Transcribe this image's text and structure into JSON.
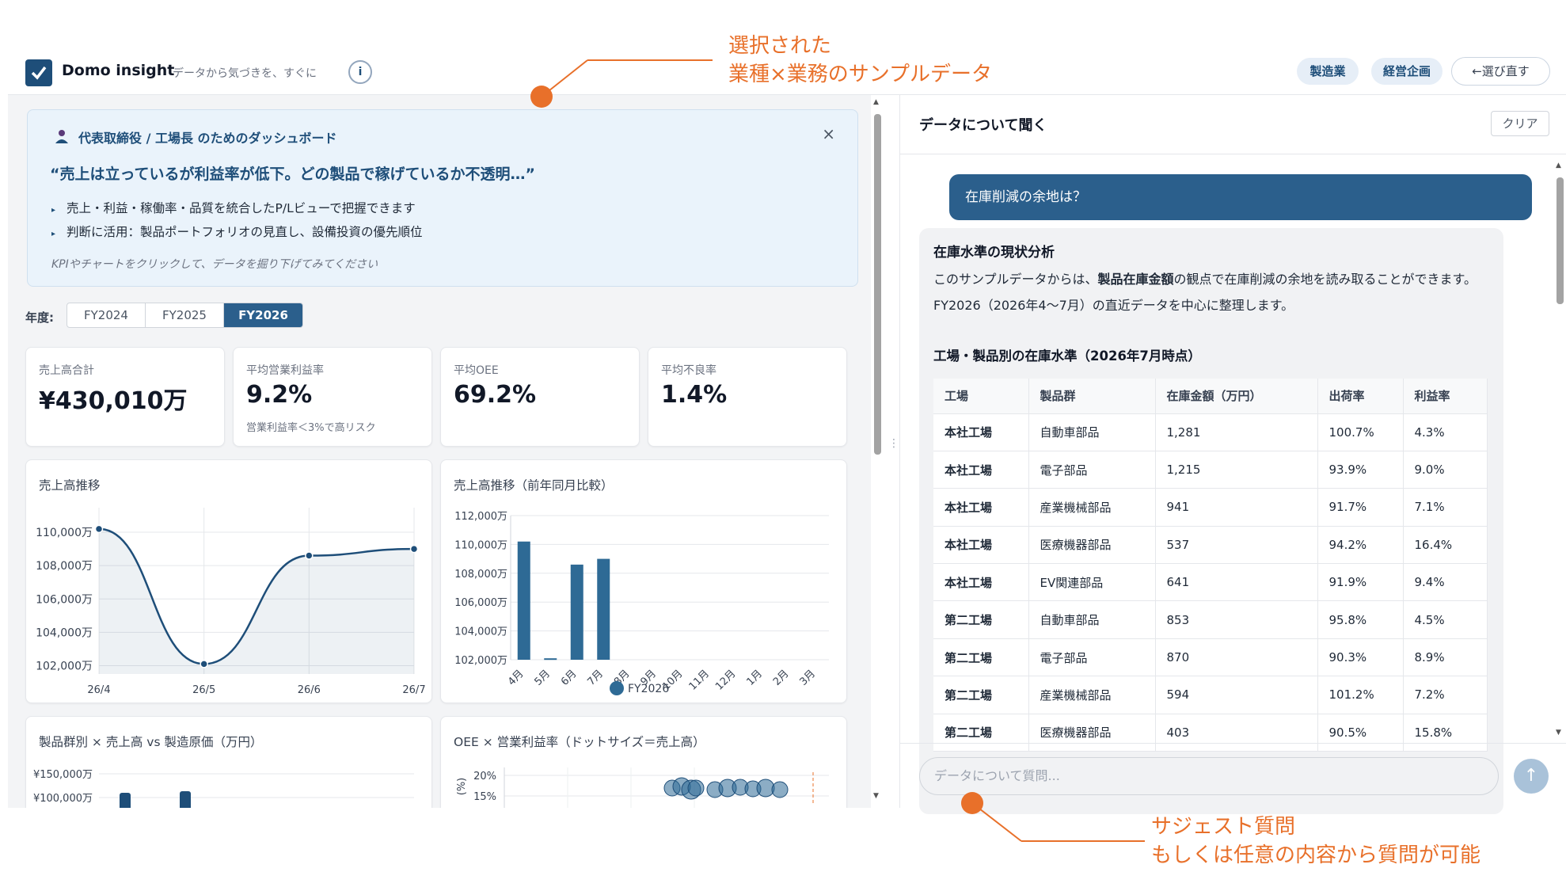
{
  "header": {
    "brand": "Domo insight",
    "tagline": "データから気づきを、すぐに",
    "info_icon": "ⓘ",
    "tags": [
      "製造業",
      "経営企画"
    ],
    "reselect": "←選び直す"
  },
  "banner": {
    "heading": "代表取締役 / 工場長 のためのダッシュボード",
    "quote": "“売上は立っているが利益率が低下。どの製品で稼げているか不透明…”",
    "bullets": [
      "売上・利益・稼働率・品質を統合したP/Lビューで把握できます",
      "判断に活用：製品ポートフォリオの見直し、設備投資の優先順位"
    ],
    "hint": "KPIやチャートをクリックして、データを掘り下げてみてください",
    "close": "×"
  },
  "fiscal_year": {
    "label": "年度:",
    "options": [
      "FY2024",
      "FY2025",
      "FY2026"
    ],
    "selected": "FY2026"
  },
  "kpis": [
    {
      "label": "売上高合計",
      "value": "¥430,010万",
      "sub": ""
    },
    {
      "label": "平均営業利益率",
      "value": "9.2%",
      "sub": "営業利益率＜3%で高リスク"
    },
    {
      "label": "平均OEE",
      "value": "69.2%",
      "sub": ""
    },
    {
      "label": "平均不良率",
      "value": "1.4%",
      "sub": ""
    }
  ],
  "chart_data": [
    {
      "type": "line",
      "title": "売上高推移",
      "x": [
        "26/4",
        "26/5",
        "26/6",
        "26/7"
      ],
      "values": [
        110200,
        102100,
        108600,
        109000
      ],
      "yticks": [
        "110,000万",
        "108,000万",
        "106,000万",
        "104,000万",
        "102,000万"
      ],
      "ylim": [
        101500,
        111000
      ]
    },
    {
      "type": "bar",
      "title": "売上高推移（前年同月比較）",
      "categories": [
        "4月",
        "5月",
        "6月",
        "7月",
        "8月",
        "9月",
        "10月",
        "11月",
        "12月",
        "1月",
        "2月",
        "3月"
      ],
      "series": [
        {
          "name": "FY2026",
          "values": [
            110200,
            102100,
            108600,
            109000,
            null,
            null,
            null,
            null,
            null,
            null,
            null,
            null
          ]
        }
      ],
      "yticks": [
        "112,000万",
        "110,000万",
        "108,000万",
        "106,000万",
        "104,000万",
        "102,000万"
      ],
      "ylim": [
        102000,
        112000
      ]
    },
    {
      "type": "bar",
      "title": "製品群別 × 売上高 vs 製造原価（万円）",
      "yticks": [
        "¥150,000万",
        "¥100,000万"
      ]
    },
    {
      "type": "scatter",
      "title": "OEE × 営業利益率（ドットサイズ＝売上高）",
      "ylabel": "(%)",
      "yticks": [
        "20%",
        "15%"
      ]
    }
  ],
  "chat": {
    "title": "データについて聞く",
    "clear": "クリア",
    "user_message": "在庫削減の余地は？",
    "answer_heading": "在庫水準の現状分析",
    "answer_text_1": "このサンプルデータからは、",
    "answer_text_bold": "製品在庫金額",
    "answer_text_2": "の観点で在庫削減の余地を読み取ることができます。FY2026（2026年4〜7月）の直近データを中心に整理します。",
    "table_heading": "工場・製品別の在庫水準（2026年7月時点）",
    "table_headers": [
      "工場",
      "製品群",
      "在庫金額（万円）",
      "出荷率",
      "利益率"
    ],
    "table_rows": [
      [
        "本社工場",
        "自動車部品",
        "1,281",
        "100.7%",
        "4.3%"
      ],
      [
        "本社工場",
        "電子部品",
        "1,215",
        "93.9%",
        "9.0%"
      ],
      [
        "本社工場",
        "産業機械部品",
        "941",
        "91.7%",
        "7.1%"
      ],
      [
        "本社工場",
        "医療機器部品",
        "537",
        "94.2%",
        "16.4%"
      ],
      [
        "本社工場",
        "EV関連部品",
        "641",
        "91.9%",
        "9.4%"
      ],
      [
        "第二工場",
        "自動車部品",
        "853",
        "95.8%",
        "4.5%"
      ],
      [
        "第二工場",
        "電子部品",
        "870",
        "90.3%",
        "8.9%"
      ],
      [
        "第二工場",
        "産業機械部品",
        "594",
        "101.2%",
        "7.2%"
      ],
      [
        "第二工場",
        "医療機器部品",
        "403",
        "90.5%",
        "15.8%"
      ]
    ],
    "input_placeholder": "データについて質問...",
    "send_icon": "↑"
  },
  "annotations": {
    "top_line1": "選択された",
    "top_line2": "業種×業務のサンプルデータ",
    "bottom_line1": "サジェスト質問",
    "bottom_line2": "もしくは任意の内容から質問が可能",
    "color": "#e8702a"
  },
  "colors": {
    "accent": "#1e4e79",
    "bar": "#2e6a95",
    "active": "#2b5f8c"
  }
}
